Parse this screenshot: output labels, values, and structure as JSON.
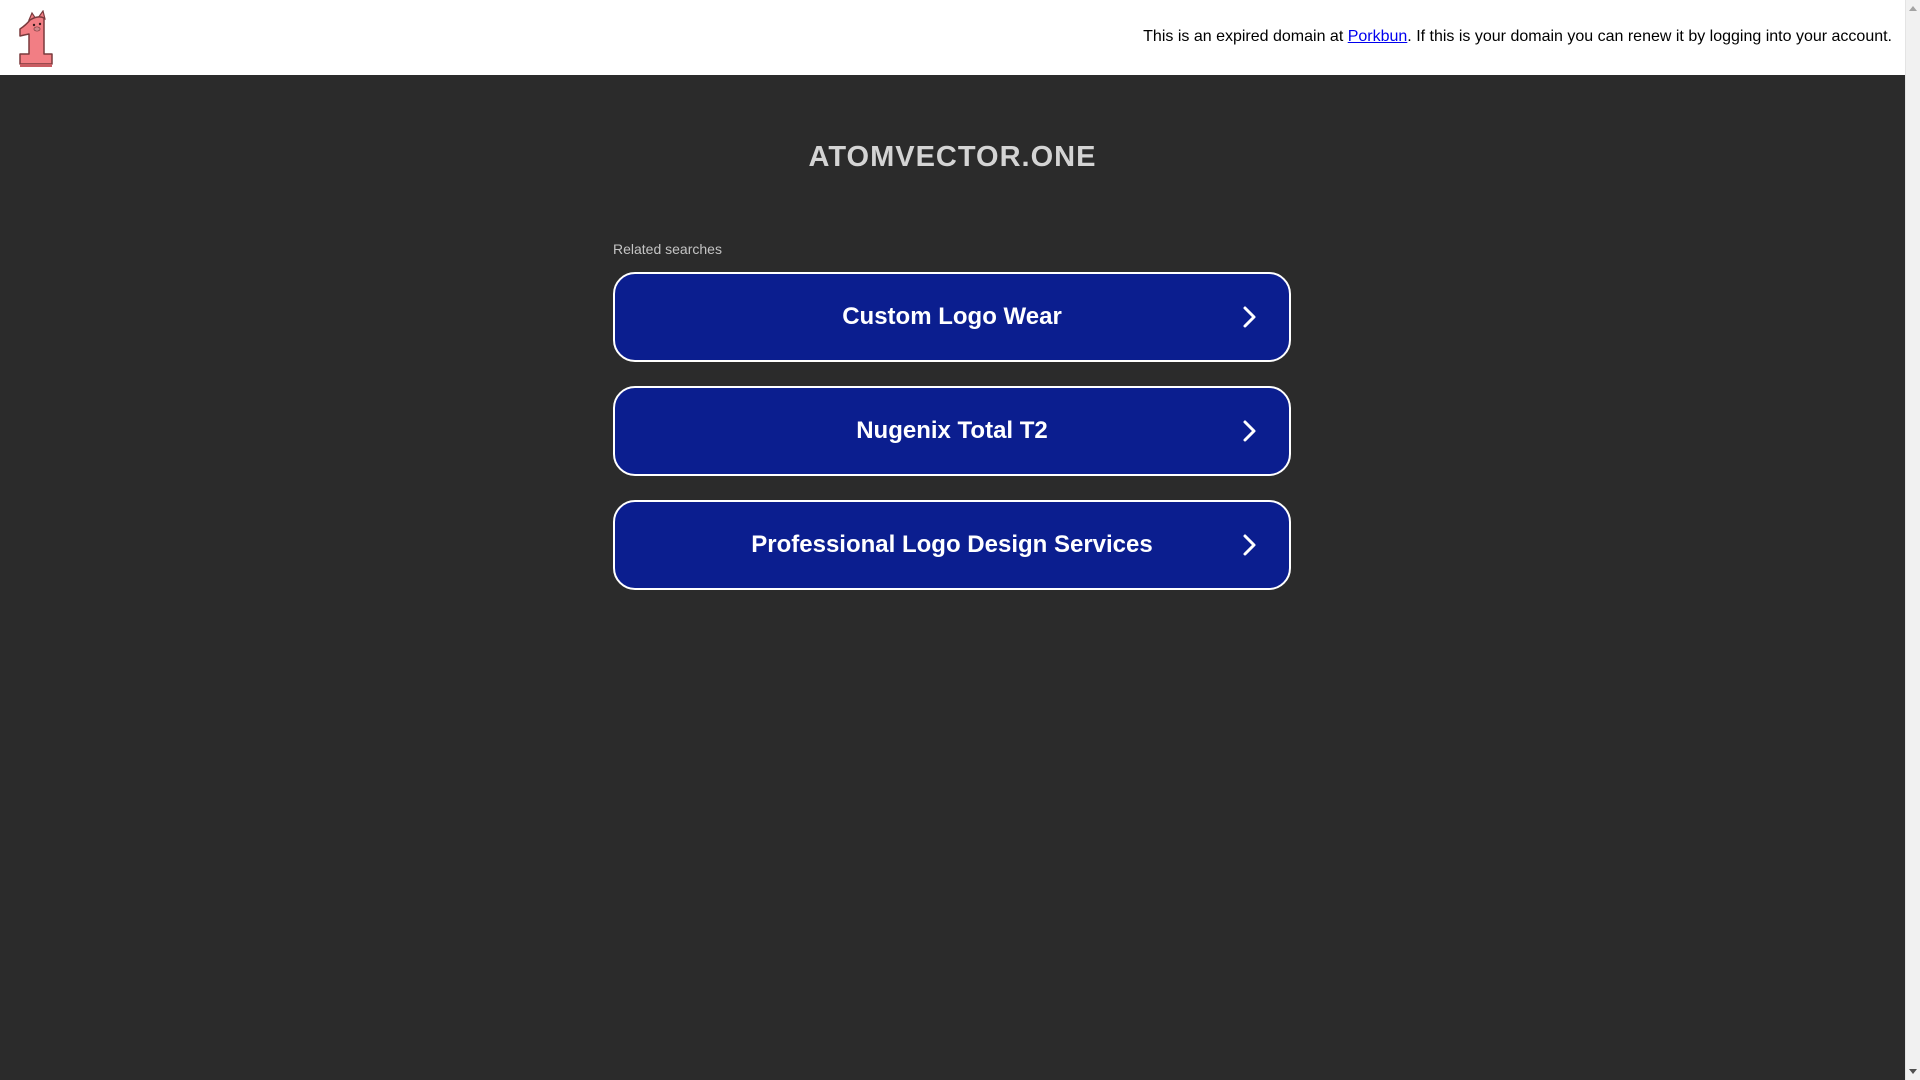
{
  "header": {
    "notice_before": "This is an expired domain at ",
    "registrar_link": "Porkbun",
    "notice_after": ". If this is your domain you can renew it by logging into your account.",
    "logo_icon": "porkbun-pig-one-icon",
    "logo_color": "#f27e84"
  },
  "main": {
    "domain": "ATOMVECTOR.ONE",
    "related_label": "Related searches",
    "searches": [
      {
        "label": "Custom Logo Wear"
      },
      {
        "label": "Nugenix Total T2"
      },
      {
        "label": "Professional Logo Design Services"
      }
    ]
  },
  "colors": {
    "background": "#2b2b2b",
    "button": "#0b1e8f",
    "button_border": "#ffffff",
    "link": "#0000ee"
  }
}
